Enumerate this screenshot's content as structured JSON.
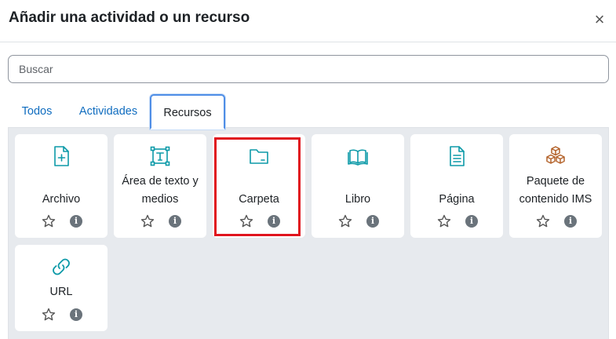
{
  "dialog": {
    "title": "Añadir una actividad o un recurso",
    "close_glyph": "×"
  },
  "search": {
    "placeholder": "Buscar"
  },
  "tabs": [
    {
      "label": "Todos",
      "active": false
    },
    {
      "label": "Actividades",
      "active": false
    },
    {
      "label": "Recursos",
      "active": true
    }
  ],
  "colors": {
    "link": "#0f6cbf",
    "icon_teal": "#0d9aa8",
    "icon_brown": "#b4632b",
    "highlight": "#e0141e",
    "panel_bg": "#e7eaee"
  },
  "items": [
    {
      "name_lines": [
        "Archivo"
      ],
      "icon": "file-plus-icon"
    },
    {
      "name_lines": [
        "Área de texto y",
        "medios"
      ],
      "icon": "text-box-icon"
    },
    {
      "name_lines": [
        "Carpeta"
      ],
      "icon": "folder-icon",
      "highlighted": true
    },
    {
      "name_lines": [
        "Libro"
      ],
      "icon": "book-icon"
    },
    {
      "name_lines": [
        "Página"
      ],
      "icon": "page-icon"
    },
    {
      "name_lines": [
        "Paquete de",
        "contenido IMS"
      ],
      "icon": "package-icon"
    },
    {
      "name_lines": [
        "URL"
      ],
      "icon": "link-icon"
    }
  ],
  "info_glyph": "i"
}
